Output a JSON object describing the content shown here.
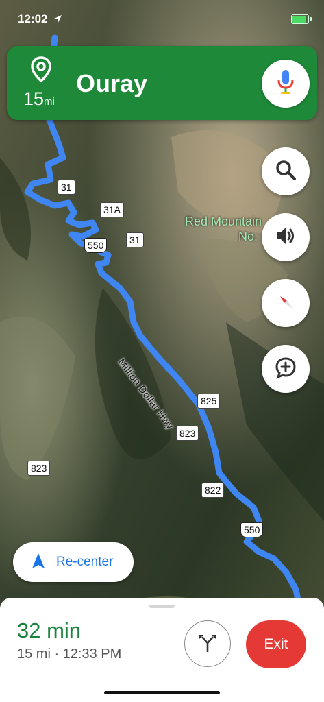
{
  "status_bar": {
    "time": "12:02",
    "battery_level": 0.8
  },
  "banner": {
    "destination": "Ouray",
    "distance_value": "15",
    "distance_unit": "mi",
    "color": "#1e8a39"
  },
  "map": {
    "place_label": "Red Mountain\nNo. 3",
    "place_label_line1": "Red Mountain",
    "place_label_line2": "No.",
    "road_name": "Million Dollar Hwy",
    "shields": [
      "31",
      "31A",
      "31",
      "550",
      "825",
      "823",
      "823",
      "822",
      "550"
    ],
    "route_color": "#4a8cf7"
  },
  "controls": {
    "search": "search-icon",
    "sound": "volume-icon",
    "compass": "compass-icon",
    "report": "add-report-icon",
    "recenter_label": "Re-center"
  },
  "trip": {
    "eta_duration": "32 min",
    "eta_detail": "15 mi · 12:33 PM",
    "exit_label": "Exit",
    "accent": "#18843b",
    "exit_color": "#e53935"
  }
}
